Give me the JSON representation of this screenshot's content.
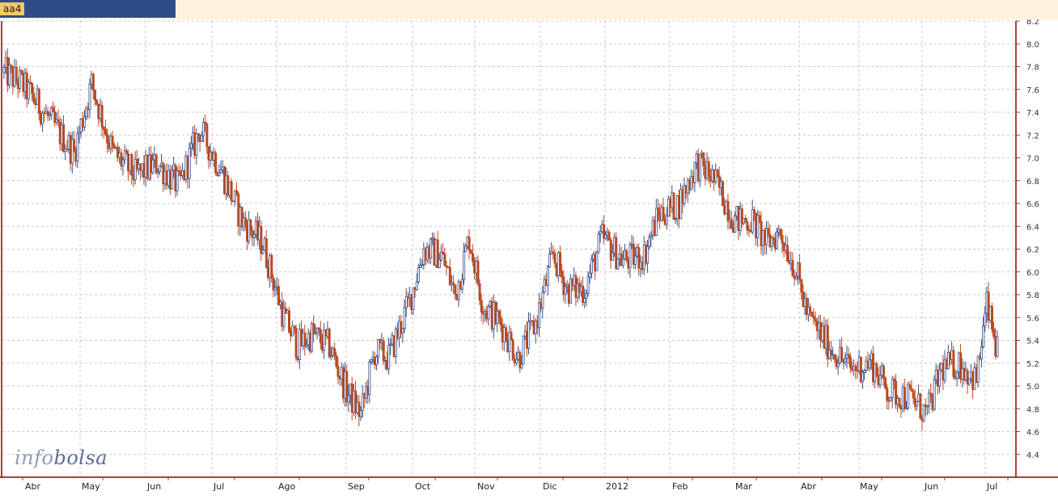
{
  "window": {
    "tab_label": "aa4"
  },
  "logo": {
    "part1": "info",
    "part2": "bolsa"
  },
  "colors": {
    "up": "#3a4f8c",
    "down": "#b94a22",
    "grid": "#c8c8c8",
    "axis": "#8b0000"
  },
  "chart_data": {
    "type": "candlestick",
    "title": "",
    "ylim": [
      4.2,
      8.2
    ],
    "y_ticks": [
      4.4,
      4.6,
      4.8,
      5.0,
      5.2,
      5.4,
      5.6,
      5.8,
      6.0,
      6.2,
      6.4,
      6.6,
      6.8,
      7.0,
      7.2,
      7.4,
      7.6,
      7.8,
      8.0,
      8.2
    ],
    "y_tick_labels": [
      "4.4",
      "4.6",
      "4.8",
      "5.0",
      "5.2",
      "5.4",
      "5.6",
      "5.8",
      "6.0",
      "6.2",
      "6.4",
      "6.6",
      "6.8",
      "7.0",
      "7.2",
      "7.4",
      "7.6",
      "7.8",
      "8.0",
      "8.2"
    ],
    "x_months": [
      "Abr",
      "May",
      "Jun",
      "Jul",
      "Ago",
      "Sep",
      "Oct",
      "Nov",
      "Dic",
      "2012",
      "Feb",
      "Mar",
      "Abr",
      "May",
      "Jun",
      "Jul"
    ],
    "grid": true,
    "price_path": [
      [
        0,
        7.75
      ],
      [
        10,
        7.65
      ],
      [
        18,
        7.5
      ],
      [
        30,
        7.25
      ],
      [
        40,
        7.05
      ],
      [
        50,
        7.65
      ],
      [
        62,
        7.05
      ],
      [
        75,
        6.85
      ],
      [
        88,
        6.95
      ],
      [
        100,
        6.75
      ],
      [
        112,
        7.25
      ],
      [
        124,
        6.9
      ],
      [
        136,
        6.45
      ],
      [
        148,
        6.25
      ],
      [
        160,
        5.6
      ],
      [
        168,
        5.35
      ],
      [
        176,
        5.45
      ],
      [
        186,
        5.35
      ],
      [
        196,
        4.95
      ],
      [
        204,
        4.75
      ],
      [
        212,
        5.3
      ],
      [
        220,
        5.25
      ],
      [
        232,
        5.75
      ],
      [
        240,
        6.2
      ],
      [
        250,
        6.15
      ],
      [
        258,
        5.8
      ],
      [
        266,
        6.3
      ],
      [
        274,
        5.7
      ],
      [
        284,
        5.55
      ],
      [
        294,
        5.25
      ],
      [
        304,
        5.55
      ],
      [
        314,
        6.15
      ],
      [
        322,
        5.85
      ],
      [
        332,
        5.85
      ],
      [
        342,
        6.3
      ],
      [
        354,
        6.1
      ],
      [
        366,
        6.15
      ],
      [
        374,
        6.5
      ],
      [
        386,
        6.6
      ],
      [
        396,
        6.95
      ],
      [
        404,
        6.85
      ],
      [
        410,
        6.7
      ],
      [
        418,
        6.45
      ],
      [
        428,
        6.45
      ],
      [
        436,
        6.25
      ],
      [
        444,
        6.35
      ],
      [
        452,
        6.05
      ],
      [
        460,
        5.6
      ],
      [
        472,
        5.35
      ],
      [
        484,
        5.15
      ],
      [
        496,
        5.2
      ],
      [
        506,
        4.95
      ],
      [
        518,
        4.9
      ],
      [
        528,
        4.75
      ],
      [
        536,
        5.15
      ],
      [
        546,
        5.2
      ],
      [
        556,
        5.05
      ],
      [
        562,
        5.7
      ],
      [
        568,
        5.3
      ],
      [
        572,
        5.2
      ]
    ],
    "total_bars": 575,
    "last_bar_index": 568
  }
}
